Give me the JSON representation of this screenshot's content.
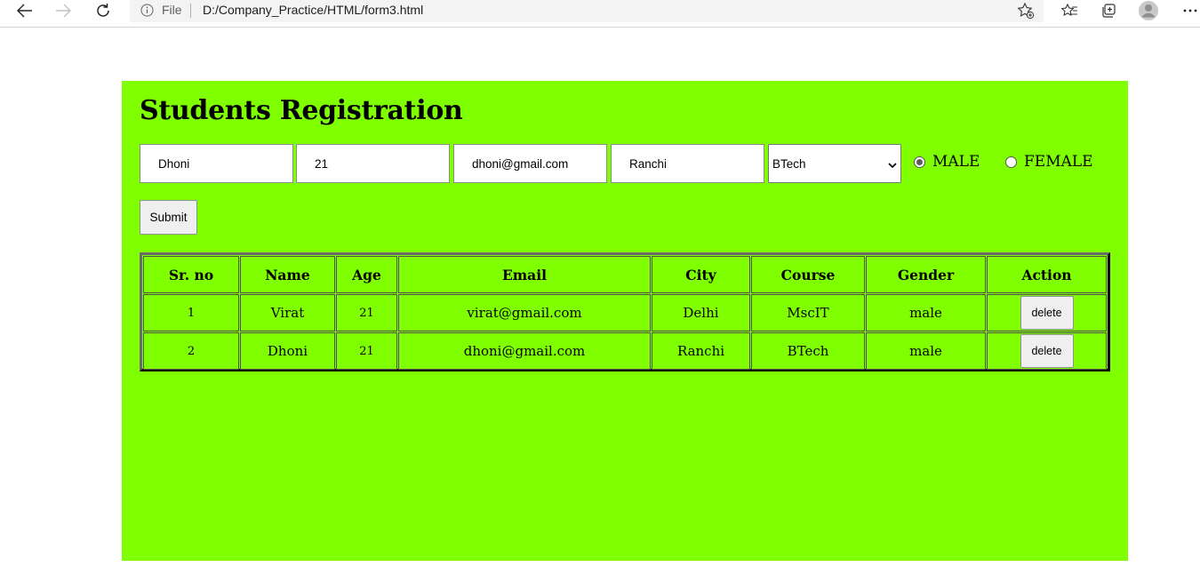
{
  "browser": {
    "scheme_label": "File",
    "url": "D:/Company_Practice/HTML/form3.html"
  },
  "page": {
    "title": "Students Registration",
    "form": {
      "name_value": "Dhoni",
      "age_value": "21",
      "email_value": "dhoni@gmail.com",
      "city_value": "Ranchi",
      "course_selected": "BTech",
      "gender_options": [
        {
          "label": "MALE",
          "checked": true
        },
        {
          "label": "FEMALE",
          "checked": false
        }
      ],
      "submit_label": "Submit"
    },
    "table": {
      "headers": [
        "Sr. no",
        "Name",
        "Age",
        "Email",
        "City",
        "Course",
        "Gender",
        "Action"
      ],
      "rows": [
        {
          "sr": "1",
          "name": "Virat",
          "age": "21",
          "email": "virat@gmail.com",
          "city": "Delhi",
          "course": "MscIT",
          "gender": "male",
          "action": "delete"
        },
        {
          "sr": "2",
          "name": "Dhoni",
          "age": "21",
          "email": "dhoni@gmail.com",
          "city": "Ranchi",
          "course": "BTech",
          "gender": "male",
          "action": "delete"
        }
      ]
    }
  },
  "colors": {
    "panel_background": "#7fff00",
    "browser_toolbar": "#ffffff",
    "address_bar": "#f3f3f3"
  },
  "icons": [
    "back-icon",
    "forward-icon",
    "refresh-icon",
    "info-icon",
    "favorite-add-icon",
    "favorites-icon",
    "collections-icon",
    "profile-avatar-icon",
    "more-icon"
  ]
}
